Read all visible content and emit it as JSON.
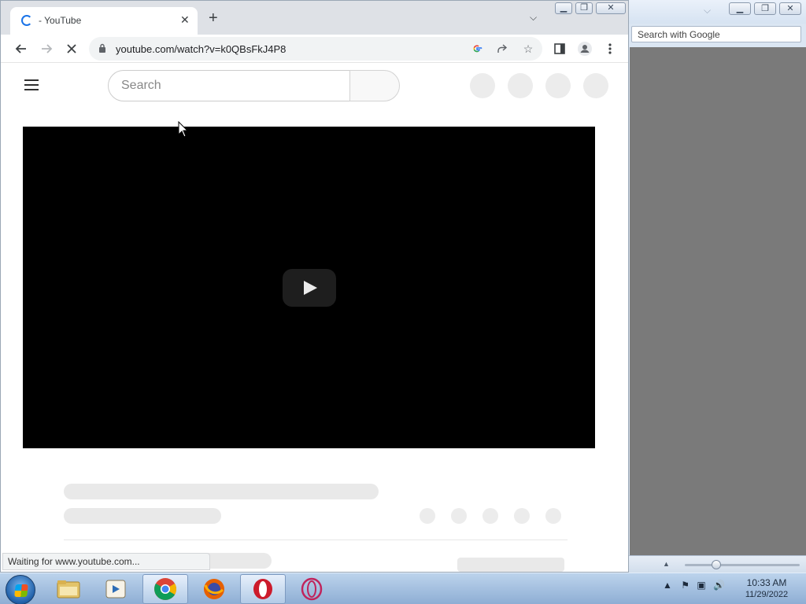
{
  "background_window": {
    "search_placeholder": "Search with Google"
  },
  "browser": {
    "tab_title": "- YouTube",
    "tab_close": "✕",
    "new_tab": "+",
    "url": "youtube.com/watch?v=k0QBsFkJ4P8",
    "status_text": "Waiting for www.youtube.com..."
  },
  "youtube": {
    "search_placeholder": "Search"
  },
  "taskbar": {
    "time": "10:33 AM",
    "date": "11/29/2022",
    "apps": [
      "windows-explorer",
      "media-player",
      "chrome",
      "firefox",
      "opera",
      "opera-gx"
    ]
  },
  "colors": {
    "accent_blue": "#1a73e8",
    "skeleton": "#e9e9e9",
    "player_bg": "#000000"
  }
}
